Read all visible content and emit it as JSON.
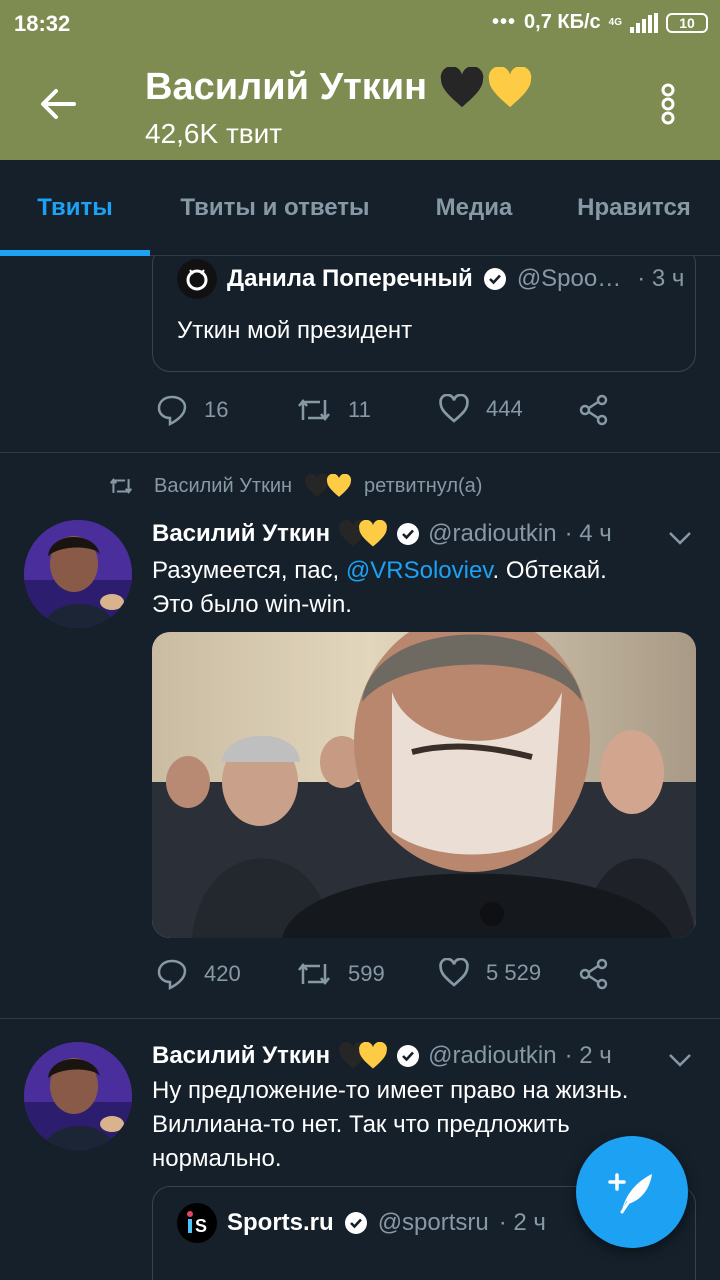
{
  "status_bar": {
    "time": "18:32",
    "network_speed": "0,7 КБ/с",
    "network_type": "4G",
    "battery": "10"
  },
  "header": {
    "title": "Василий Уткин",
    "subtitle": "42,6K твит",
    "title_emoji": [
      "black-heart",
      "yellow-heart"
    ]
  },
  "tabs": [
    {
      "label": "Твиты",
      "active": true
    },
    {
      "label": "Твиты и ответы",
      "active": false
    },
    {
      "label": "Медиа",
      "active": false
    },
    {
      "label": "Нравится",
      "active": false
    }
  ],
  "tweets": [
    {
      "quote": {
        "name": "Данила Поперечный",
        "handle": "@Spoo…",
        "time": "· 3 ч",
        "text": "Уткин мой президент"
      },
      "replies": "16",
      "retweets": "11",
      "likes": "444"
    },
    {
      "retweet_label": "Василий Уткин",
      "retweet_suffix": "ретвитнул(а)",
      "name": "Василий Уткин",
      "handle": "@radioutkin",
      "time": "· 4 ч",
      "text_before": "Разумеется, пас, ",
      "mention": "@VRSoloviev",
      "text_after": ". Обтекай.",
      "text_line2": "Это было win-win.",
      "replies": "420",
      "retweets": "599",
      "likes": "5 529"
    },
    {
      "name": "Василий Уткин",
      "handle": "@radioutkin",
      "time": "· 2 ч",
      "text_line1": "Ну предложение-то имеет право на жизнь.",
      "text_line2": "Виллиана-то нет. Так что предложить",
      "text_line3": "нормально.",
      "quote": {
        "name": "Sports.ru",
        "handle": "@sportsru",
        "time": "· 2 ч"
      }
    }
  ],
  "colors": {
    "header_bg": "#7e8c52",
    "background": "#15202b",
    "accent": "#1da1f2",
    "muted": "#8899a6"
  }
}
